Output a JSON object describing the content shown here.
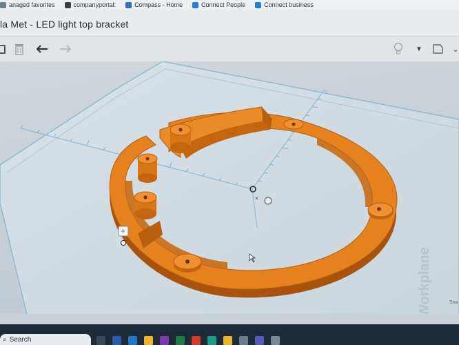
{
  "bookmarks": [
    {
      "label": "anaged favorites",
      "color": "#6f7c8a"
    },
    {
      "label": "companyportal:",
      "color": "#3a3f46"
    },
    {
      "label": "Compass - Home",
      "color": "#2f6fb4"
    },
    {
      "label": "Connect People",
      "color": "#2b7bd6"
    },
    {
      "label": "Connect business",
      "color": "#2b7bd6"
    }
  ],
  "window": {
    "title": "la Met - LED light top bracket"
  },
  "toolbar": {
    "icons": [
      "copy-icon",
      "trash-icon",
      "undo-icon",
      "redo-icon",
      "lightbulb-icon",
      "dropdown-caret-icon",
      "notes-icon",
      "chevron-down-icon"
    ]
  },
  "workplane": {
    "label": "Workplane",
    "snap": "Sna",
    "ring_color": "#e6821e",
    "grid_color": "#7fb6d0"
  },
  "taskbar": {
    "search_placeholder": "Search",
    "apps": [
      {
        "icon": "desktop-icon",
        "color": "#394656"
      },
      {
        "icon": "word-icon",
        "color": "#2b5aa7"
      },
      {
        "icon": "outlook-icon",
        "color": "#1f78c9"
      },
      {
        "icon": "file-explorer-icon",
        "color": "#f0b42c"
      },
      {
        "icon": "onenote-icon",
        "color": "#7b3aa9"
      },
      {
        "icon": "excel-icon",
        "color": "#1e7a43"
      },
      {
        "icon": "pdf-icon",
        "color": "#d23b2b"
      },
      {
        "icon": "edge-icon",
        "color": "#1c9a88"
      },
      {
        "icon": "chrome-icon",
        "color": "#e4b72c"
      },
      {
        "icon": "snip-icon",
        "color": "#6b7a8c"
      },
      {
        "icon": "teams-icon",
        "color": "#5959b8"
      },
      {
        "icon": "settings-icon",
        "color": "#7c8896"
      }
    ]
  }
}
